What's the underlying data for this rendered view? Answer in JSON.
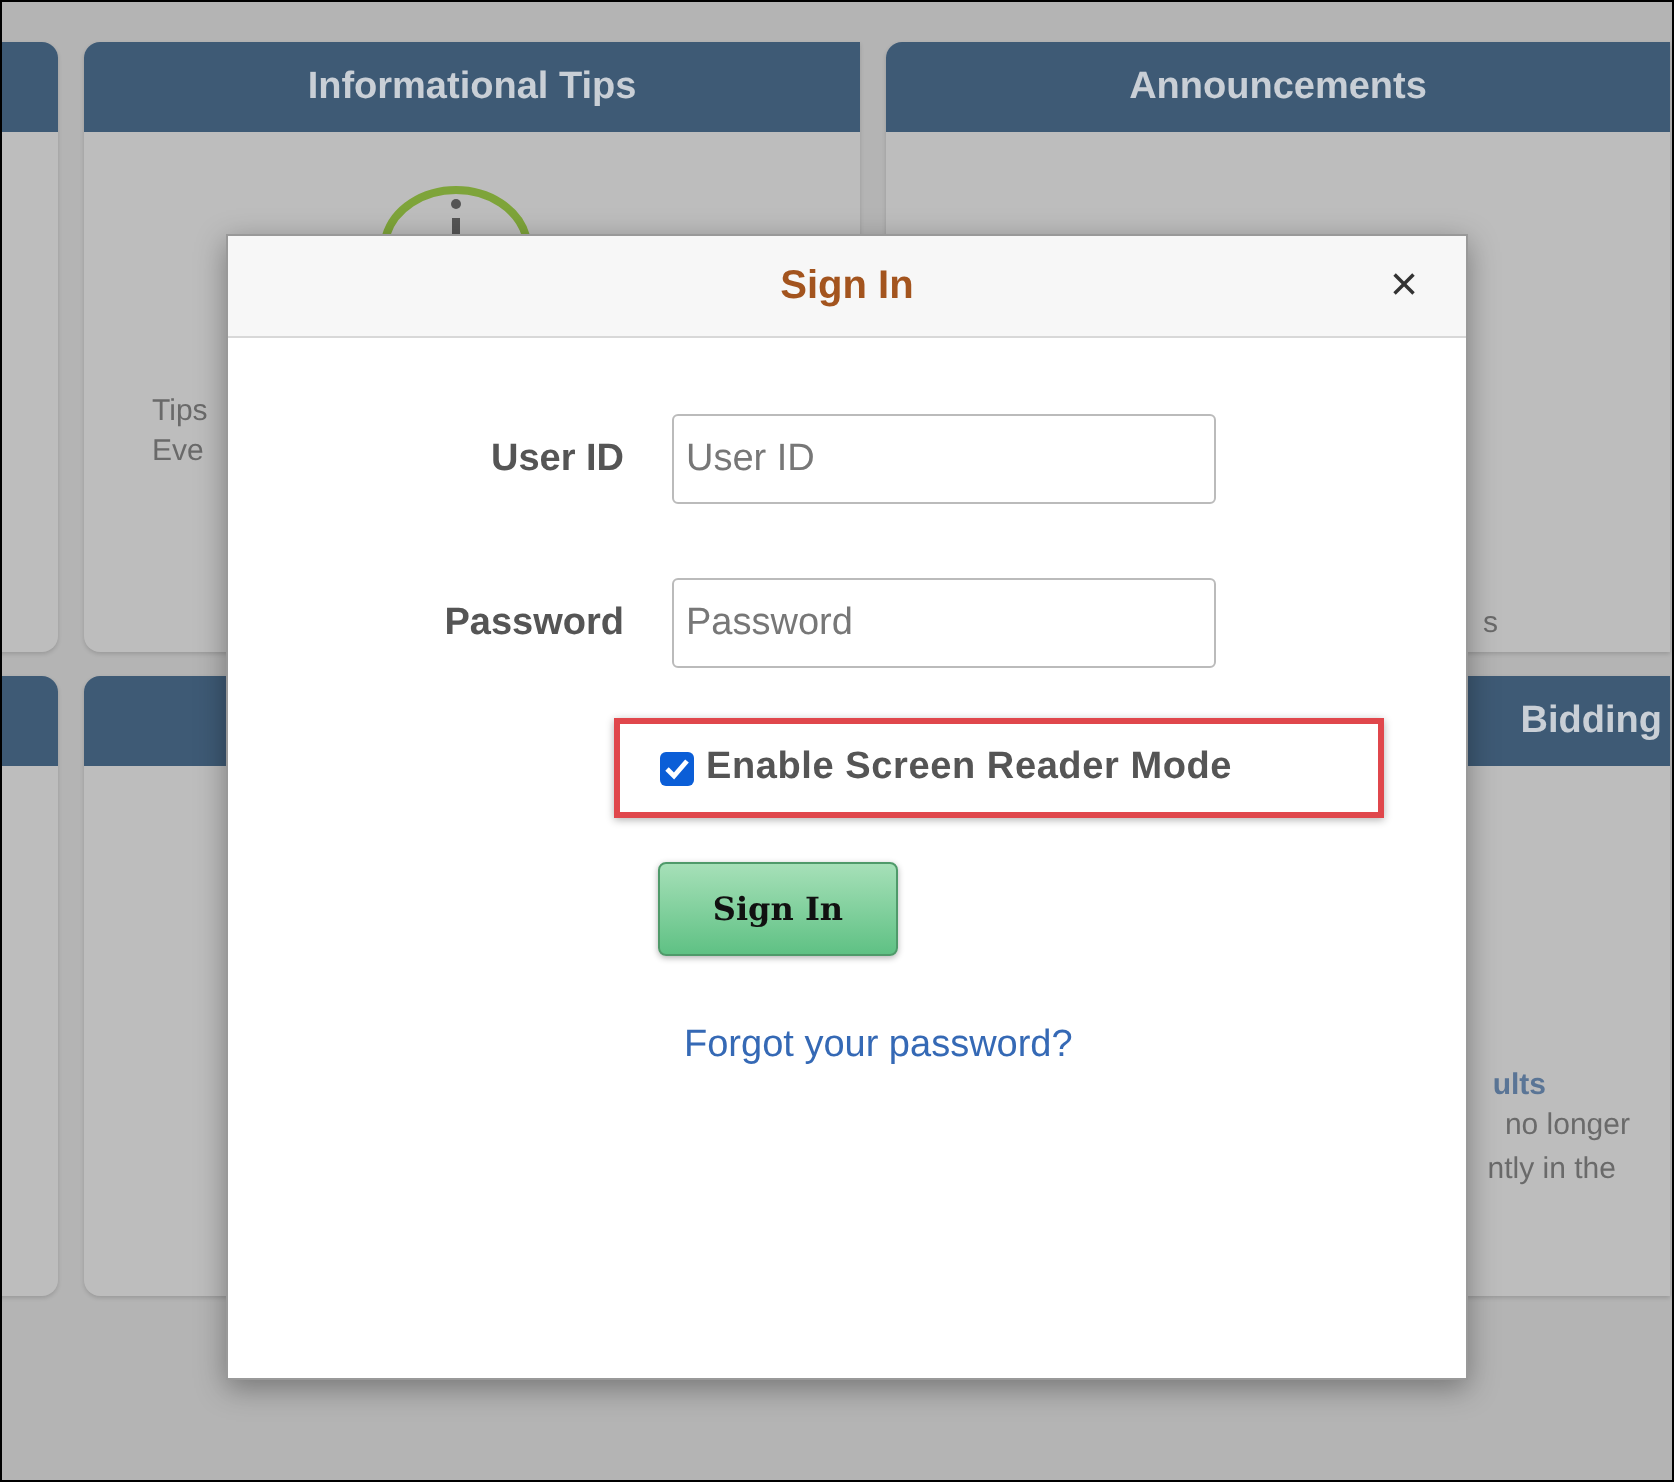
{
  "tiles": [
    {
      "kind": "cut"
    },
    {
      "kind": "tile",
      "title": "Informational Tips",
      "icon": true,
      "texts": [
        "Tips",
        "Eve"
      ]
    },
    {
      "kind": "tile",
      "title": "Announcements",
      "texts": [
        "s"
      ]
    },
    {
      "kind": "cut"
    },
    {
      "kind": "tile"
    },
    {
      "kind": "tile",
      "title": "Bidding",
      "heading": "ults",
      "texts": [
        "no longer",
        "ntly in the"
      ]
    }
  ],
  "dialog": {
    "title": "Sign In",
    "close": "×",
    "fields": [
      {
        "label": "User ID",
        "placeholder": "User ID"
      },
      {
        "label": "Password",
        "placeholder": "Password"
      }
    ],
    "screen_reader": {
      "label": "Enable Screen Reader Mode",
      "checked": true,
      "highlighted": true
    },
    "submit": "Sign In",
    "forgot_link": "Forgot your password?"
  }
}
